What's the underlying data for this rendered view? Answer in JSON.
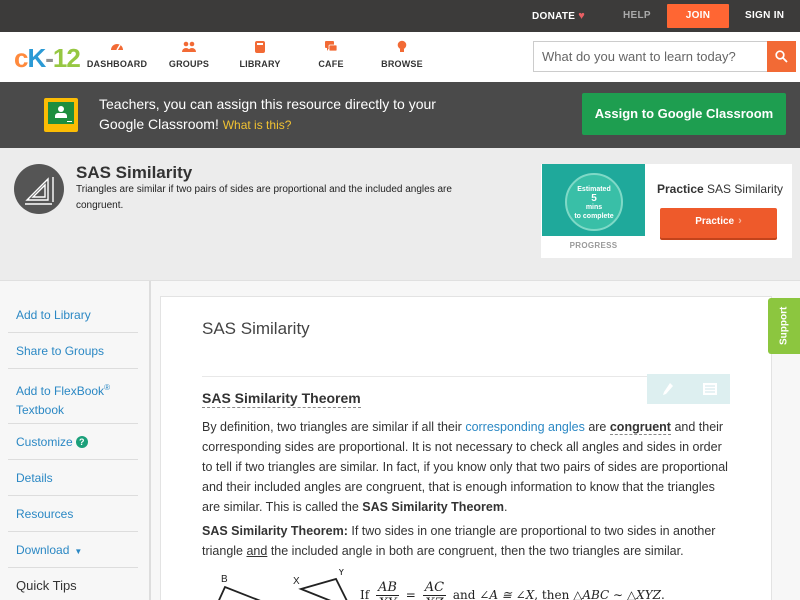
{
  "topbar": {
    "donate": "DONATE",
    "help": "HELP",
    "join": "JOIN",
    "signin": "SIGN IN"
  },
  "nav": {
    "logo": {
      "c": "c",
      "k": "K",
      "dash": "-",
      "num": "12"
    },
    "items": [
      {
        "label": "DASHBOARD",
        "icon": "dashboard-icon",
        "color": "#f26a35"
      },
      {
        "label": "GROUPS",
        "icon": "groups-icon",
        "color": "#f26a35"
      },
      {
        "label": "LIBRARY",
        "icon": "library-icon",
        "color": "#f26a35"
      },
      {
        "label": "CAFE",
        "icon": "cafe-icon",
        "color": "#f26a35"
      },
      {
        "label": "BROWSE",
        "icon": "browse-icon",
        "color": "#f26a35"
      }
    ],
    "search": {
      "placeholder": "What do you want to learn today?"
    }
  },
  "banner": {
    "text": "Teachers, you can assign this resource directly to your Google Classroom!",
    "link": "What is this?",
    "button": "Assign to Google Classroom"
  },
  "header": {
    "title": "SAS Similarity",
    "description": "Triangles are similar if two pairs of sides are proportional and the included angles are congruent."
  },
  "practice": {
    "estimated": "Estimated",
    "mins_num": "5",
    "mins": "mins",
    "to_complete": "to complete",
    "progress_label": "PROGRESS",
    "title_bold": "Practice",
    "title_rest": "SAS Similarity",
    "button": "Practice"
  },
  "sidebar": {
    "items": [
      {
        "label": "Add to Library"
      },
      {
        "label": "Share to Groups"
      },
      {
        "label": "Add to FlexBook",
        "sup": "®",
        "line2": "Textbook"
      },
      {
        "label": "Customize",
        "badge": "?"
      },
      {
        "label": "Details"
      },
      {
        "label": "Resources"
      },
      {
        "label": "Download",
        "caret": "▼"
      }
    ],
    "quicktips": "Quick Tips"
  },
  "content": {
    "title": "SAS Similarity",
    "heading": "SAS Similarity Theorem",
    "p1": {
      "a": "By definition, two triangles are similar if all their ",
      "link": "corresponding angles",
      "b": " are ",
      "congruent": "congruent",
      "c": " and their corresponding sides are proportional. It is not necessary to check all angles and sides in order to tell if two triangles are similar. In fact, if you know only that two pairs of sides are proportional and their included angles are congruent, that is enough information to know that the triangles are similar. This is called the ",
      "bold": "SAS Similarity Theorem",
      "d": "."
    },
    "p2": {
      "bold": "SAS Similarity Theorem:",
      "a": " If two sides in one triangle are proportional to two sides in another triangle ",
      "and": "and",
      "b": " the included angle in both are congruent, then the two triangles are similar."
    },
    "figure": {
      "labelB": "B",
      "labelX": "X",
      "labelY": "Y"
    },
    "formula": {
      "if": "If",
      "num1": "AB",
      "den1": "XY",
      "eq": "=",
      "num2": "AC",
      "den2": "XZ",
      "and": "and",
      "angle": "∠A ≅ ∠X",
      "then": ", then",
      "sim": "△ABC ∼ △XYZ",
      "end": "."
    }
  },
  "support": "Support"
}
